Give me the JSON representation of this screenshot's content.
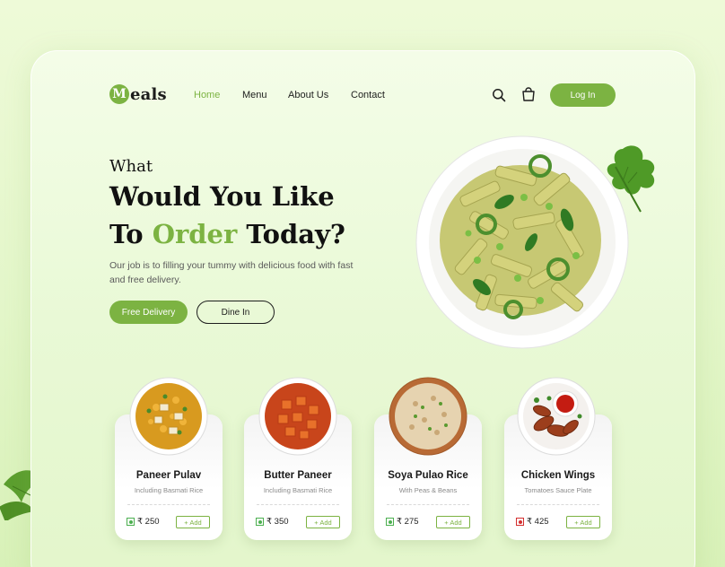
{
  "brand": {
    "logo_letter": "M",
    "logo_rest": "eals",
    "accent": "#7cb342"
  },
  "nav": {
    "items": [
      "Home",
      "Menu",
      "About Us",
      "Contact"
    ],
    "active": "Home"
  },
  "header": {
    "login_label": "Log In",
    "icons": [
      "search-icon",
      "shopping-bag-icon"
    ]
  },
  "hero": {
    "line_what": "What",
    "line1": "Would You Like",
    "line2_pre": "To ",
    "line2_accent": "Order",
    "line2_post": " Today?",
    "description": "Our job is to filling your tummy with delicious food with fast and free delivery.",
    "primary_button": "Free Delivery",
    "secondary_button": "Dine In"
  },
  "cards": [
    {
      "title": "Paneer Pulav",
      "subtitle": "Including Basmati Rice",
      "price": "₹ 250",
      "type": "veg",
      "add_label": "+ Add"
    },
    {
      "title": "Butter Paneer",
      "subtitle": "Including Basmati Rice",
      "price": "₹ 350",
      "type": "veg",
      "add_label": "+ Add"
    },
    {
      "title": "Soya Pulao Rice",
      "subtitle": "With Peas & Beans",
      "price": "₹ 275",
      "type": "veg",
      "add_label": "+ Add"
    },
    {
      "title": "Chicken Wings",
      "subtitle": "Tomatoes Sauce Plate",
      "price": "₹ 425",
      "type": "non-veg",
      "add_label": "+ Add"
    }
  ]
}
